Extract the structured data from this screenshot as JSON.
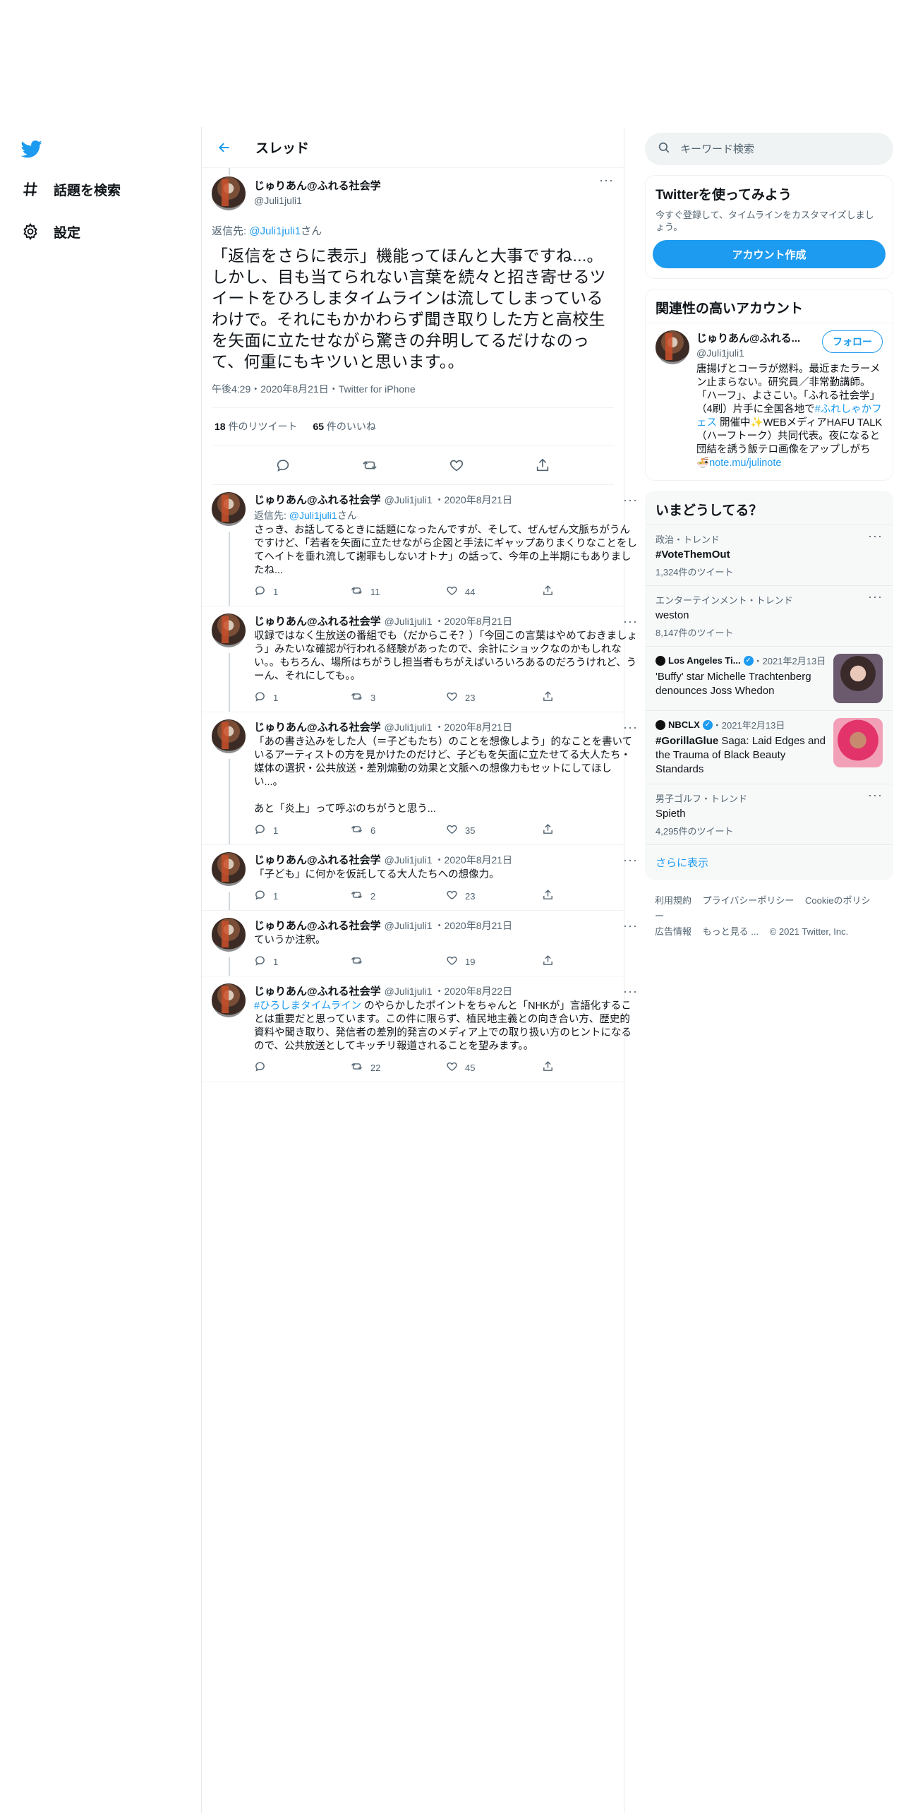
{
  "nav": {
    "items": [
      {
        "label": "話題を検索",
        "icon": "hash-icon"
      },
      {
        "label": "設定",
        "icon": "gear-icon"
      }
    ]
  },
  "header": {
    "title": "スレッド"
  },
  "focus_tweet": {
    "display_name": "じゅりあん@ふれる社会学",
    "handle": "@Juli1juli1",
    "reply_prefix": "返信先: ",
    "reply_handle": "@Juli1juli1",
    "reply_suffix": "さん",
    "text": "「返信をさらに表示」機能ってほんと大事ですね...。しかし、目も当てられない言葉を続々と招き寄せるツイートをひろしまタイムラインは流してしまっているわけで。それにもかかわらず聞き取りした方と高校生を矢面に立たせながら驚きの弁明してるだけなのって、何重にもキツいと思います。。",
    "meta": "午後4:29・2020年8月21日・Twitter for iPhone",
    "retweets": "18",
    "retweets_label": " 件のリツイート",
    "likes": "65",
    "likes_label": " 件のいいね"
  },
  "replies": [
    {
      "display_name": "じゅりあん@ふれる社会学",
      "handle": "@Juli1juli1",
      "date": "・2020年8月21日",
      "reply_prefix": "返信先: ",
      "reply_handle": "@Juli1juli1",
      "reply_suffix": "さん",
      "text": "さっき、お話してるときに話題になったんですが、そして、ぜんぜん文脈ちがうんですけど、「若者を矢面に立たせながら企図と手法にギャップありまくりなことをしてヘイトを垂れ流して謝罪もしないオトナ」の話って、今年の上半期にもありましたね...",
      "replies": "1",
      "retweets": "11",
      "likes": "44"
    },
    {
      "display_name": "じゅりあん@ふれる社会学",
      "handle": "@Juli1juli1",
      "date": "・2020年8月21日",
      "text": "収録ではなく生放送の番組でも（だからこそ？）「今回この言葉はやめておきましょう」みたいな確認が行われる経験があったので、余計にショックなのかもしれない。。もちろん、場所はちがうし担当者もちがえばいろいろあるのだろうけれど、うーん、それにしても。。",
      "replies": "1",
      "retweets": "3",
      "likes": "23"
    },
    {
      "display_name": "じゅりあん@ふれる社会学",
      "handle": "@Juli1juli1",
      "date": "・2020年8月21日",
      "text": "「あの書き込みをした人（＝子どもたち）のことを想像しよう」的なことを書いているアーティストの方を見かけたのだけど、子どもを矢面に立たせてる大人たち・媒体の選択・公共放送・差別煽動の効果と文脈への想像力もセットにしてほしい...。\n\nあと「炎上」って呼ぶのちがうと思う...",
      "replies": "1",
      "retweets": "6",
      "likes": "35"
    },
    {
      "display_name": "じゅりあん@ふれる社会学",
      "handle": "@Juli1juli1",
      "date": "・2020年8月21日",
      "text": "「子ども」に何かを仮託してる大人たちへの想像力。",
      "replies": "1",
      "retweets": "2",
      "likes": "23"
    },
    {
      "display_name": "じゅりあん@ふれる社会学",
      "handle": "@Juli1juli1",
      "date": "・2020年8月21日",
      "text": "ていうか注釈。",
      "replies": "1",
      "retweets": "",
      "likes": "19"
    },
    {
      "display_name": "じゅりあん@ふれる社会学",
      "handle": "@Juli1juli1",
      "date": "・2020年8月22日",
      "hashtag": "#ひろしまタイムライン",
      "text": " のやらかしたポイントをちゃんと「NHKが」言語化することは重要だと思っています。この件に限らず、植民地主義との向き合い方、歴史的資料や聞き取り、発信者の差別的発言のメディア上での取り扱い方のヒントになるので、公共放送としてキッチリ報道されることを望みます。。",
      "replies": "",
      "retweets": "22",
      "likes": "45"
    }
  ],
  "sidebar": {
    "search_placeholder": "キーワード検索",
    "signup": {
      "title": "Twitterを使ってみよう",
      "desc": "今すぐ登録して、タイムラインをカスタマイズしましょう。",
      "button": "アカウント作成"
    },
    "related": {
      "title": "関連性の高いアカウント",
      "display_name": "じゅりあん@ふれる...",
      "handle": "@Juli1juli1",
      "follow": "フォロー",
      "bio_1": "唐揚げとコーラが燃料。最近またラーメン止まらない。研究員／非常勤講師。「ハーフ」、よさこい。「ふれる社会学」（4刷）片手に全国各地で",
      "bio_tag": "#ふれしゃかフェス",
      "bio_2": " 開催中✨WEBメディアHAFU TALK（ハーフトーク）共同代表。夜になると団結を誘う飯テロ画像をアップしがち🍜",
      "bio_link": "note.mu/julinote"
    },
    "trends": {
      "title": "いまどうしてる？",
      "items": [
        {
          "context": "政治・トレンド",
          "name": "#VoteThemOut",
          "count": "1,324件のツイート"
        },
        {
          "context": "エンターテインメント・トレンド",
          "name": "weston",
          "count": "8,147件のツイート"
        }
      ],
      "news": [
        {
          "source": "Los Angeles Ti...",
          "date": "・2021年2月13日",
          "headline": "'Buffy' star Michelle Trachtenberg denounces Joss Whedon"
        },
        {
          "source": "NBCLX",
          "date": "・2021年2月13日",
          "headline_tag": "#GorillaGlue",
          "headline": " Saga: Laid Edges and the Trauma of Black Beauty Standards"
        }
      ],
      "last": {
        "context": "男子ゴルフ・トレンド",
        "name": "Spieth",
        "count": "4,295件のツイート"
      },
      "show_more": "さらに表示"
    },
    "footer": {
      "links": [
        "利用規約",
        "プライバシーポリシー",
        "Cookieのポリシー",
        "広告情報",
        "もっと見る ...",
        "© 2021 Twitter, Inc."
      ]
    }
  },
  "colors": {
    "accent": "#1d9bf0",
    "secondary_text": "#536471"
  }
}
